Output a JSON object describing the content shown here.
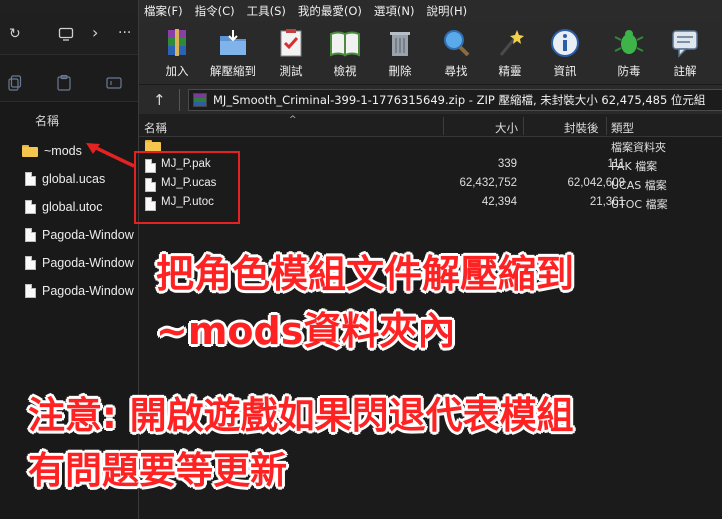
{
  "explorer": {
    "nav": {
      "refresh_icon": "refresh-icon",
      "view_icon": "monitor-icon",
      "chevron": "›",
      "more": "···"
    },
    "column_name": "名稱",
    "items": [
      {
        "label": "~mods",
        "kind": "folder"
      },
      {
        "label": "global.ucas",
        "kind": "file"
      },
      {
        "label": "global.utoc",
        "kind": "file"
      },
      {
        "label": "Pagoda-Window",
        "kind": "file"
      },
      {
        "label": "Pagoda-Window",
        "kind": "file"
      },
      {
        "label": "Pagoda-Window",
        "kind": "file"
      }
    ]
  },
  "winrar": {
    "menu": [
      "檔案(F)",
      "指令(C)",
      "工具(S)",
      "我的最愛(O)",
      "選項(N)",
      "說明(H)"
    ],
    "toolbar": [
      {
        "label": "加入",
        "icon": "add-archive-icon"
      },
      {
        "label": "解壓縮到",
        "icon": "extract-to-icon"
      },
      {
        "label": "測試",
        "icon": "test-icon"
      },
      {
        "label": "檢視",
        "icon": "view-icon"
      },
      {
        "label": "刪除",
        "icon": "delete-icon"
      },
      {
        "label": "尋找",
        "icon": "find-icon"
      },
      {
        "label": "精靈",
        "icon": "wizard-icon"
      },
      {
        "label": "資訊",
        "icon": "info-icon"
      },
      {
        "label": "防毒",
        "icon": "virus-scan-icon"
      },
      {
        "label": "註解",
        "icon": "comment-icon"
      }
    ],
    "address": "MJ_Smooth_Criminal-399-1-1776315649.zip - ZIP 壓縮檔, 未封裝大小 62,475,485 位元組",
    "columns": {
      "name": "名稱",
      "size": "大小",
      "packed": "封裝後",
      "type": "類型"
    },
    "rows": [
      {
        "name": "..",
        "size": "",
        "packed": "",
        "type": "檔案資料夾",
        "kind": "folder"
      },
      {
        "name": "MJ_P.pak",
        "size": "339",
        "packed": "111",
        "type": "PAK 檔案",
        "kind": "file"
      },
      {
        "name": "MJ_P.ucas",
        "size": "62,432,752",
        "packed": "62,042,609",
        "type": "UCAS 檔案",
        "kind": "file"
      },
      {
        "name": "MJ_P.utoc",
        "size": "42,394",
        "packed": "21,361",
        "type": "UTOC 檔案",
        "kind": "file"
      }
    ]
  },
  "overlay": {
    "line1": "把角色模組文件解壓縮到",
    "line2": "~mods資料夾內",
    "line3": "注意: 開啟遊戲如果閃退代表模組",
    "line4": "有問題要等更新",
    "color": "#ff2222"
  }
}
